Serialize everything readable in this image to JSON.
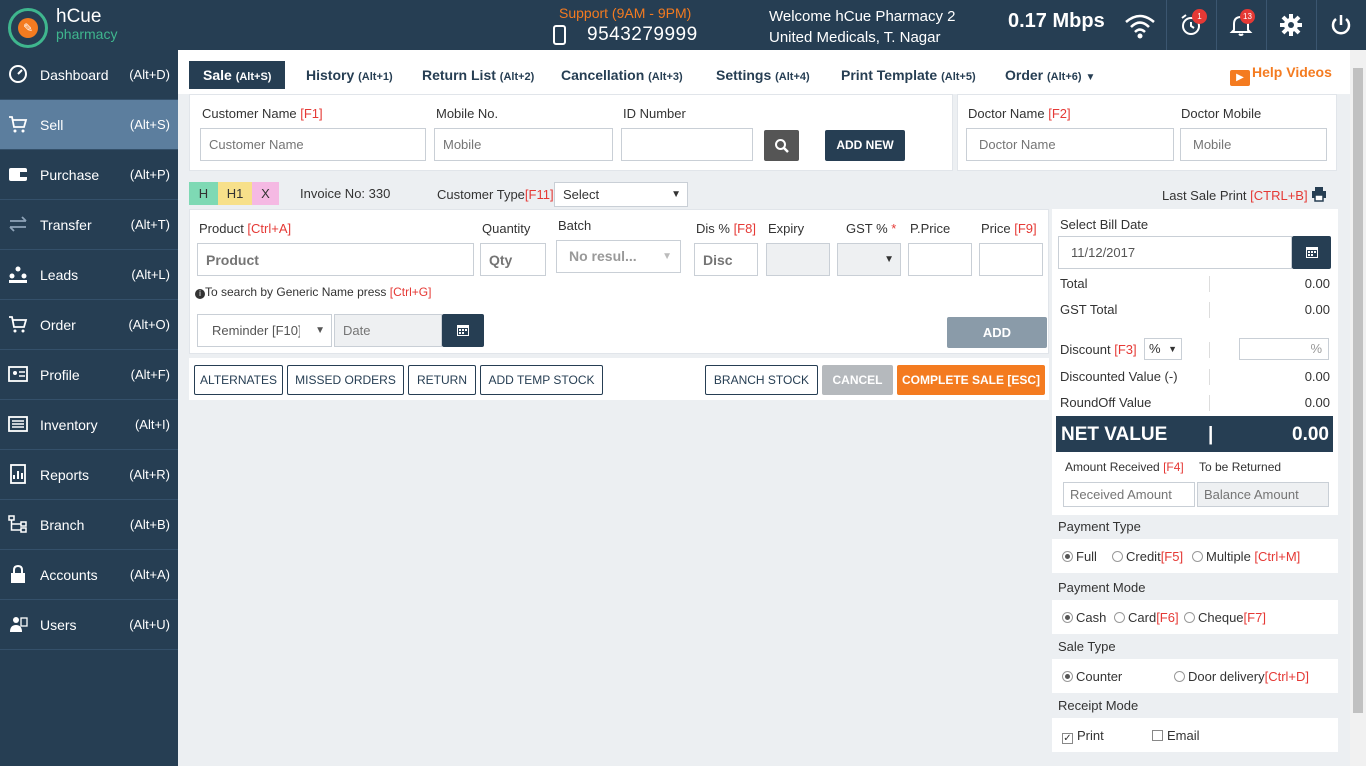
{
  "brand": {
    "name_top": "hCue",
    "name_bottom": "pharmacy"
  },
  "header": {
    "support": "Support (9AM - 9PM)",
    "phone": "9543279999",
    "welcome_line1": "Welcome hCue Pharmacy 2",
    "welcome_line2": "United Medicals, T. Nagar",
    "speed": "0.17 Mbps",
    "alarm_badge": "1",
    "notif_badge": "13"
  },
  "sidebar": {
    "items": [
      {
        "label": "Dashboard",
        "key": "(Alt+D)",
        "icon": "dashboard-icon"
      },
      {
        "label": "Sell",
        "key": "(Alt+S)",
        "icon": "cart-icon"
      },
      {
        "label": "Purchase",
        "key": "(Alt+P)",
        "icon": "wallet-icon"
      },
      {
        "label": "Transfer",
        "key": "(Alt+T)",
        "icon": "transfer-icon"
      },
      {
        "label": "Leads",
        "key": "(Alt+L)",
        "icon": "leads-icon"
      },
      {
        "label": "Order",
        "key": "(Alt+O)",
        "icon": "order-cart-icon"
      },
      {
        "label": "Profile",
        "key": "(Alt+F)",
        "icon": "profile-icon"
      },
      {
        "label": "Inventory",
        "key": "(Alt+I)",
        "icon": "inventory-icon"
      },
      {
        "label": "Reports",
        "key": "(Alt+R)",
        "icon": "reports-icon"
      },
      {
        "label": "Branch",
        "key": "(Alt+B)",
        "icon": "branch-icon"
      },
      {
        "label": "Accounts",
        "key": "(Alt+A)",
        "icon": "lock-icon"
      },
      {
        "label": "Users",
        "key": "(Alt+U)",
        "icon": "users-icon"
      }
    ]
  },
  "tabs": [
    {
      "label": "Sale",
      "key": "(Alt+S)"
    },
    {
      "label": "History",
      "key": "(Alt+1)"
    },
    {
      "label": "Return List",
      "key": "(Alt+2)"
    },
    {
      "label": "Cancellation",
      "key": "(Alt+3)"
    },
    {
      "label": "Settings",
      "key": "(Alt+4)"
    },
    {
      "label": "Print Template",
      "key": "(Alt+5)"
    },
    {
      "label": "Order",
      "key": "(Alt+6)"
    }
  ],
  "help_videos": "Help Videos",
  "customer": {
    "name_label": "Customer Name ",
    "name_key": "[F1]",
    "name_placeholder": "Customer Name",
    "mobile_label": "Mobile No.",
    "mobile_placeholder": "Mobile",
    "id_label": "ID Number",
    "add_new": "ADD NEW"
  },
  "doctor": {
    "name_label": "Doctor Name ",
    "name_key": "[F2]",
    "name_placeholder": "Doctor Name",
    "mobile_label": "Doctor Mobile",
    "mobile_placeholder": "Mobile"
  },
  "invoice": {
    "tags": [
      "H",
      "H1",
      "X"
    ],
    "number": "Invoice No: 330",
    "customer_type_label": "Customer Type",
    "customer_type_key": "[F11]",
    "customer_type_value": "Select",
    "last_sale_print": "Last Sale Print ",
    "last_sale_key": "[CTRL+B]"
  },
  "product": {
    "product_label": "Product ",
    "product_key": "[Ctrl+A]",
    "product_placeholder": "Product",
    "qty_label": "Quantity",
    "qty_placeholder": "Qty",
    "batch_label": "Batch",
    "batch_value": "No resul...",
    "dis_label": "Dis % ",
    "dis_key": "[F8]",
    "dis_placeholder": "Disc",
    "expiry_label": "Expiry",
    "gst_label": "GST % ",
    "gst_star": "*",
    "pprice_label": "P.Price",
    "price_label": "Price ",
    "price_key": "[F9]",
    "hint": "To search by Generic Name press ",
    "hint_key": "[Ctrl+G]",
    "reminder": "Reminder [F10]",
    "date_placeholder": "Date",
    "add": "ADD"
  },
  "actions": {
    "alternates": "ALTERNATES",
    "missed_orders": "MISSED ORDERS",
    "return": "RETURN",
    "add_temp_stock": "ADD TEMP STOCK",
    "branch_stock": "BRANCH STOCK",
    "cancel": "CANCEL",
    "complete_sale": "COMPLETE SALE [ESC]"
  },
  "bill": {
    "date_label": "Select Bill Date",
    "date_value": "11/12/2017",
    "total_label": "Total",
    "total_value": "0.00",
    "gst_total_label": "GST Total",
    "gst_total_value": "0.00",
    "discount_label": "Discount ",
    "discount_key": "[F3]",
    "discount_unit": "%",
    "discount_input_suffix": "%",
    "discounted_label": "Discounted Value (-)",
    "discounted_value": "0.00",
    "roundoff_label": "RoundOff Value",
    "roundoff_value": "0.00",
    "net_label": "NET VALUE",
    "net_value": "0.00",
    "amount_received_label": "Amount Received ",
    "amount_received_key": "[F4]",
    "to_be_returned_label": "To be Returned",
    "received_placeholder": "Received Amount",
    "balance_placeholder": "Balance Amount"
  },
  "payment_type": {
    "head": "Payment Type",
    "full": "Full",
    "credit": "Credit",
    "credit_key": "[F5]",
    "multiple": "Multiple ",
    "multiple_key": "[Ctrl+M]"
  },
  "payment_mode": {
    "head": "Payment Mode",
    "cash": "Cash",
    "card": "Card",
    "card_key": "[F6]",
    "cheque": "Cheque",
    "cheque_key": "[F7]"
  },
  "sale_type": {
    "head": "Sale Type",
    "counter": "Counter",
    "door": "Door delivery",
    "door_key": "[Ctrl+D]"
  },
  "receipt_mode": {
    "head": "Receipt Mode",
    "print": "Print",
    "email": "Email"
  },
  "colors": {
    "navy": "#263e53",
    "orange": "#f47b20",
    "green": "#3fb68e",
    "red": "#e53935"
  }
}
